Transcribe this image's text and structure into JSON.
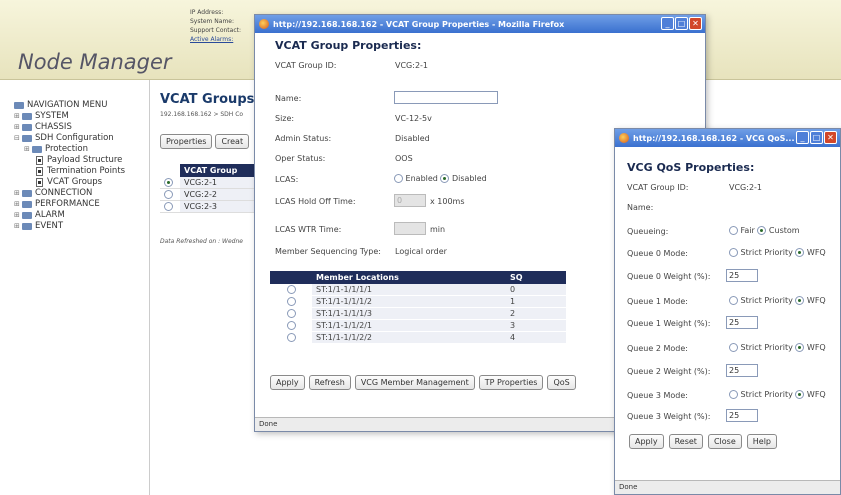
{
  "header": {
    "logo": "Node Manager",
    "info": [
      "IP Address:",
      "System Name:",
      "Support Contact:",
      "Active Alarms:"
    ]
  },
  "nav": {
    "items": [
      {
        "label": "NAVIGATION MENU",
        "level": 0,
        "kind": "root"
      },
      {
        "label": "SYSTEM",
        "level": 0,
        "kind": "folder"
      },
      {
        "label": "CHASSIS",
        "level": 0,
        "kind": "folder"
      },
      {
        "label": "SDH Configuration",
        "level": 0,
        "kind": "folder-open"
      },
      {
        "label": "Protection",
        "level": 1,
        "kind": "folder"
      },
      {
        "label": "Payload Structure",
        "level": 2,
        "kind": "doc"
      },
      {
        "label": "Termination Points",
        "level": 2,
        "kind": "doc"
      },
      {
        "label": "VCAT Groups",
        "level": 2,
        "kind": "doc"
      },
      {
        "label": "CONNECTION",
        "level": 0,
        "kind": "folder"
      },
      {
        "label": "PERFORMANCE",
        "level": 0,
        "kind": "folder"
      },
      {
        "label": "ALARM",
        "level": 0,
        "kind": "folder"
      },
      {
        "label": "EVENT",
        "level": 0,
        "kind": "folder"
      }
    ]
  },
  "content": {
    "title": "VCAT Groups",
    "breadcrumb": "192.168.168.162 > SDH Co",
    "buttons": [
      "Properties",
      "Creat"
    ],
    "table_header": "VCAT Group",
    "rows": [
      {
        "name": "VCG:2-1",
        "selected": true
      },
      {
        "name": "VCG:2-2",
        "selected": false
      },
      {
        "name": "VCG:2-3",
        "selected": false
      }
    ],
    "refresh_text": "Data Refreshed on : Wedne"
  },
  "vcat_window": {
    "titlebar": "http://192.168.168.162 - VCAT Group Properties - Mozilla Firefox",
    "heading": "VCAT Group Properties:",
    "fields": {
      "group_id_label": "VCAT Group ID:",
      "group_id": "VCG:2-1",
      "name_label": "Name:",
      "name_value": "",
      "size_label": "Size:",
      "size": "VC-12-5v",
      "admin_label": "Admin Status:",
      "admin": "Disabled",
      "oper_label": "Oper Status:",
      "oper": "OOS",
      "lcas_label": "LCAS:",
      "lcas_enabled": "Enabled",
      "lcas_disabled": "Disabled",
      "lcas_selected": "Disabled",
      "hold_label": "LCAS Hold Off Time:",
      "hold_value": "0",
      "hold_unit": "x 100ms",
      "wtr_label": "LCAS WTR Time:",
      "wtr_value": "",
      "wtr_unit": "min",
      "seq_label": "Member Sequencing Type:",
      "seq": "Logical order"
    },
    "members": {
      "headers": [
        "Member Locations",
        "SQ"
      ],
      "rows": [
        {
          "loc": "ST:1/1-1/1/1/1",
          "sq": "0"
        },
        {
          "loc": "ST:1/1-1/1/1/2",
          "sq": "1"
        },
        {
          "loc": "ST:1/1-1/1/1/3",
          "sq": "2"
        },
        {
          "loc": "ST:1/1-1/1/2/1",
          "sq": "3"
        },
        {
          "loc": "ST:1/1-1/1/2/2",
          "sq": "4"
        }
      ]
    },
    "buttons": [
      "Apply",
      "Refresh",
      "VCG Member Management",
      "TP Properties",
      "QoS"
    ],
    "status": "Done"
  },
  "qos_window": {
    "titlebar": "http://192.168.168.162 - VCG QoS...",
    "heading": "VCG QoS Properties:",
    "group_id_label": "VCAT Group ID:",
    "group_id": "VCG:2-1",
    "name_label": "Name:",
    "queueing_label": "Queueing:",
    "queueing_fair": "Fair",
    "queueing_custom": "Custom",
    "queues": [
      {
        "mode_label": "Queue 0 Mode:",
        "weight_label": "Queue 0 Weight (%):",
        "weight": "25"
      },
      {
        "mode_label": "Queue 1 Mode:",
        "weight_label": "Queue 1 Weight (%):",
        "weight": "25"
      },
      {
        "mode_label": "Queue 2 Mode:",
        "weight_label": "Queue 2 Weight (%):",
        "weight": "25"
      },
      {
        "mode_label": "Queue 3 Mode:",
        "weight_label": "Queue 3 Weight (%):",
        "weight": "25"
      }
    ],
    "mode_strict": "Strict Priority",
    "mode_wfq": "WFQ",
    "buttons": [
      "Apply",
      "Reset",
      "Close",
      "Help"
    ],
    "status": "Done"
  }
}
